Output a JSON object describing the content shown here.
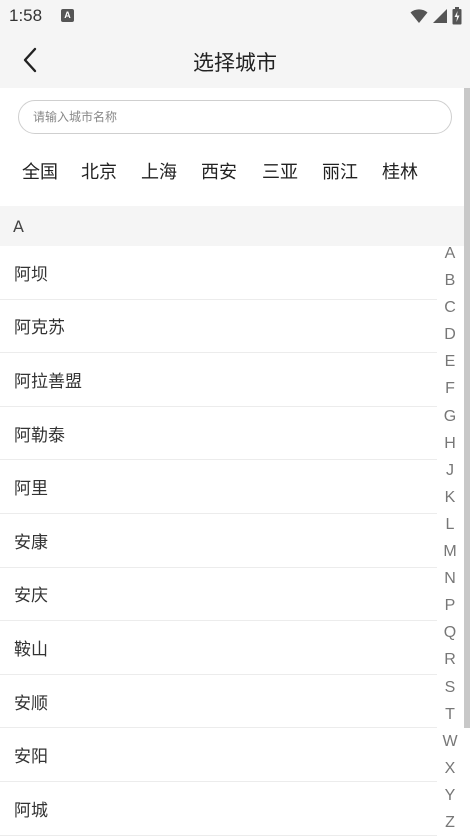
{
  "status": {
    "time": "1:58",
    "app_icon_letter": "A"
  },
  "header": {
    "title": "选择城市"
  },
  "search": {
    "placeholder": "请输入城市名称"
  },
  "hot_cities": [
    "全国",
    "北京",
    "上海",
    "西安",
    "三亚",
    "丽江",
    "桂林"
  ],
  "section": {
    "letter": "A"
  },
  "cities": [
    "阿坝",
    "阿克苏",
    "阿拉善盟",
    "阿勒泰",
    "阿里",
    "安康",
    "安庆",
    "鞍山",
    "安顺",
    "安阳",
    "阿城"
  ],
  "index_letters": [
    "A",
    "B",
    "C",
    "D",
    "E",
    "F",
    "G",
    "H",
    "J",
    "K",
    "L",
    "M",
    "N",
    "P",
    "Q",
    "R",
    "S",
    "T",
    "W",
    "X",
    "Y",
    "Z"
  ],
  "colors": {
    "header_bg": "#f5f5f5",
    "text": "#333333",
    "divider": "#ececec"
  }
}
